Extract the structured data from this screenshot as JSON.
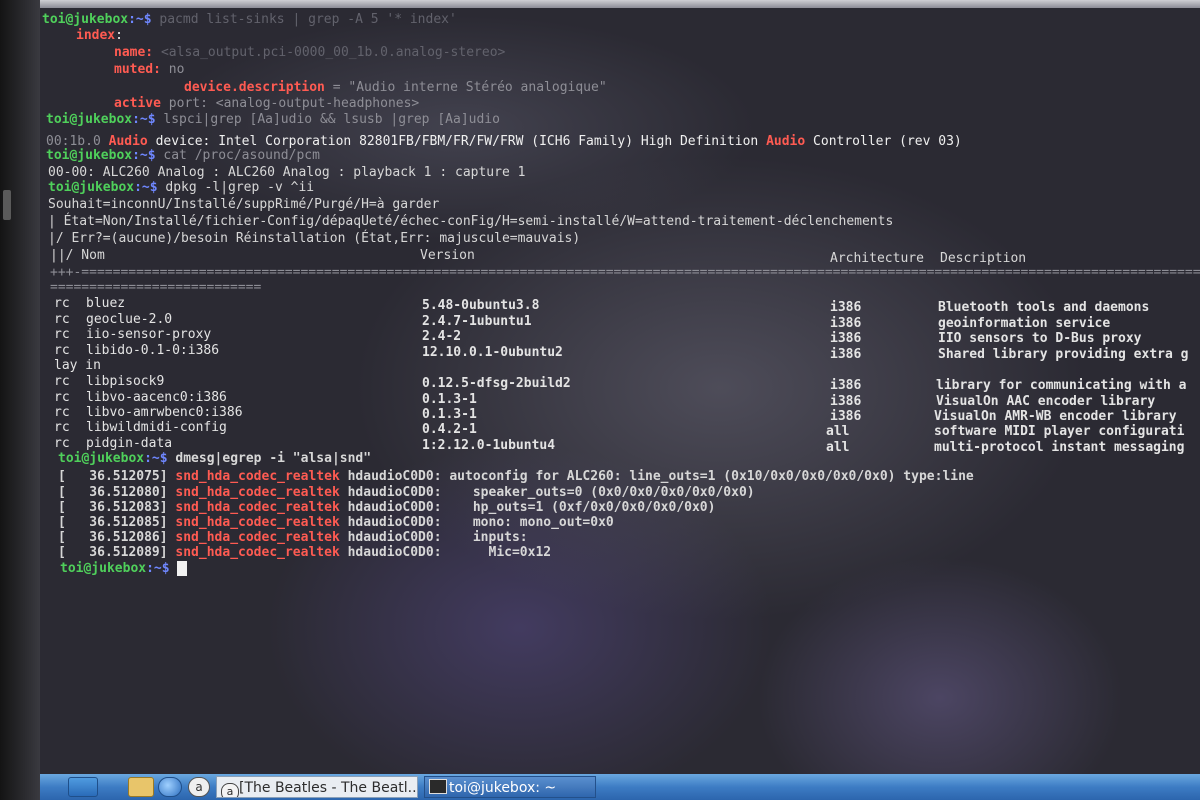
{
  "terminal": {
    "prompt": "toi@jukebox",
    "prompt_suffix": ":~$",
    "lines": {
      "l0_tail": " pacmd list-sinks | grep -A 5 '* index'",
      "index_key": "index",
      "name_key": "name:",
      "name_val": "<alsa_output.pci-0000_00_1b.0.analog-stereo>",
      "muted_key": "muted:",
      "muted_val": "no",
      "desc_key": "device.description",
      "desc_val": "= \"Audio interne Stéréo analogique\"",
      "active_key": "active",
      "active_val": "port: <analog-output-headphones>",
      "cmd_lspci": " lspci|grep [Aa]udio && lsusb |grep [Aa]udio",
      "lspci_pre": "00:1b.0 ",
      "lspci_hl1": "Audio",
      "lspci_mid": " device: Intel Corporation 82801FB/FBM/FR/FW/FRW (ICH6 Family) High Definition ",
      "lspci_hl2": "Audio",
      "lspci_post": " Controller (rev 03)",
      "cmd_cat": " cat /proc/asound/pcm",
      "pcm_out": "00-00: ALC260 Analog : ALC260 Analog : playback 1 : capture 1",
      "cmd_dpkg": " dpkg -l|grep -v ^ii",
      "hdr1": "Souhait=inconnU/Installé/suppRimé/Purgé/H=à garder",
      "hdr2": "| État=Non/Installé/fichier-Config/dépaqUeté/échec-conFig/H=semi-installé/W=attend-traitement-déclenchements",
      "hdr3": "|/ Err?=(aucune)/besoin Réinstallation (État,Err: majuscule=mauvais)",
      "col_name": "||/ Nom",
      "col_version": "Version",
      "col_arch": "Architecture",
      "col_desc": "Description",
      "sep1": "+++-======================================================================================================================================================",
      "sep2": "===========================",
      "wrap": "lay in",
      "cmd_dmesg": " dmesg|egrep -i \"alsa|snd\"",
      "last_prompt_suffix": ":~$ "
    },
    "packages": [
      {
        "st": "rc",
        "name": "bluez",
        "version": "5.48-0ubuntu3.8",
        "arch": "i386",
        "desc": "Bluetooth tools and daemons"
      },
      {
        "st": "rc",
        "name": "geoclue-2.0",
        "version": "2.4.7-1ubuntu1",
        "arch": "i386",
        "desc": "geoinformation service"
      },
      {
        "st": "rc",
        "name": "iio-sensor-proxy",
        "version": "2.4-2",
        "arch": "i386",
        "desc": "IIO sensors to D-Bus proxy"
      },
      {
        "st": "rc",
        "name": "libido-0.1-0:i386",
        "version": "12.10.0.1-0ubuntu2",
        "arch": "i386",
        "desc": "Shared library providing extra g"
      },
      {
        "st": "rc",
        "name": "libpisock9",
        "version": "0.12.5-dfsg-2build2",
        "arch": "i386",
        "desc": "library for communicating with a"
      },
      {
        "st": "rc",
        "name": "libvo-aacenc0:i386",
        "version": "0.1.3-1",
        "arch": "i386",
        "desc": "VisualOn AAC encoder library"
      },
      {
        "st": "rc",
        "name": "libvo-amrwbenc0:i386",
        "version": "0.1.3-1",
        "arch": "i386",
        "desc": "VisualOn AMR-WB encoder library"
      },
      {
        "st": "rc",
        "name": "libwildmidi-config",
        "version": "0.4.2-1",
        "arch": "all",
        "desc": "software MIDI player configurati"
      },
      {
        "st": "rc",
        "name": "pidgin-data",
        "version": "1:2.12.0-1ubuntu4",
        "arch": "all",
        "desc": "multi-protocol instant messaging"
      }
    ],
    "dmesg": [
      {
        "ts": "[   36.512075]",
        "mod": "snd_hda_codec_realtek",
        "dev": "hdaudioC0D0:",
        "msg": " autoconfig for ALC260: line_outs=1 (0x10/0x0/0x0/0x0/0x0) type:line"
      },
      {
        "ts": "[   36.512080]",
        "mod": "snd_hda_codec_realtek",
        "dev": "hdaudioC0D0:",
        "msg": "    speaker_outs=0 (0x0/0x0/0x0/0x0/0x0)"
      },
      {
        "ts": "[   36.512083]",
        "mod": "snd_hda_codec_realtek",
        "dev": "hdaudioC0D0:",
        "msg": "    hp_outs=1 (0xf/0x0/0x0/0x0/0x0)"
      },
      {
        "ts": "[   36.512085]",
        "mod": "snd_hda_codec_realtek",
        "dev": "hdaudioC0D0:",
        "msg": "    mono: mono_out=0x0"
      },
      {
        "ts": "[   36.512086]",
        "mod": "snd_hda_codec_realtek",
        "dev": "hdaudioC0D0:",
        "msg": "    inputs:"
      },
      {
        "ts": "[   36.512089]",
        "mod": "snd_hda_codec_realtek",
        "dev": "hdaudioC0D0:",
        "msg": "      Mic=0x12"
      }
    ]
  },
  "taskbar": {
    "task1_label": "[The Beatles - The Beatl...",
    "task2_label": "toi@jukebox: ~",
    "icons": [
      "menu-icon",
      "files-icon",
      "browser-icon",
      "audio-player-icon",
      "terminal-icon"
    ]
  },
  "colors": {
    "prompt": "#4fd05b",
    "path": "#6f87ff",
    "highlight": "#ff5b52",
    "taskbar": "#3d7cc4"
  }
}
